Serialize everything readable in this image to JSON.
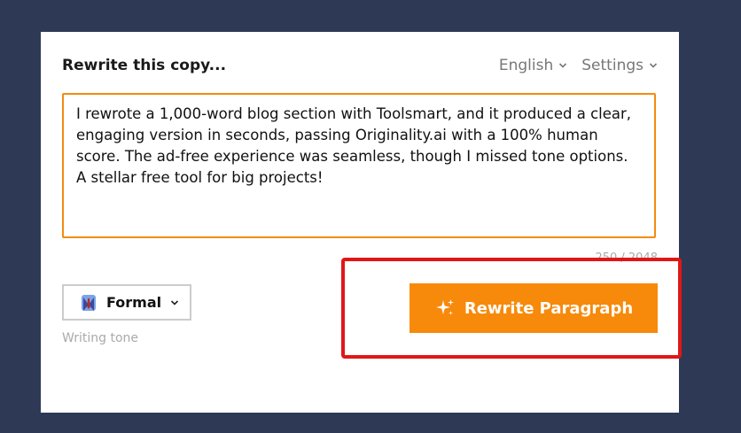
{
  "header": {
    "title": "Rewrite this copy...",
    "language_label": "English",
    "settings_label": "Settings"
  },
  "editor": {
    "text": "I rewrote a 1,000-word blog section with Toolsmart, and it produced a clear, engaging version in seconds, passing Originality.ai with a 100% human score. The ad-free experience was seamless, though I missed tone options. A stellar free tool for big projects!",
    "counter": "250 / 2048"
  },
  "tone": {
    "value": "Formal",
    "label": "Writing tone"
  },
  "action": {
    "rewrite_label": "Rewrite Paragraph"
  },
  "colors": {
    "accent": "#f78a0a",
    "highlight": "#e01717",
    "background": "#2e3a55"
  }
}
